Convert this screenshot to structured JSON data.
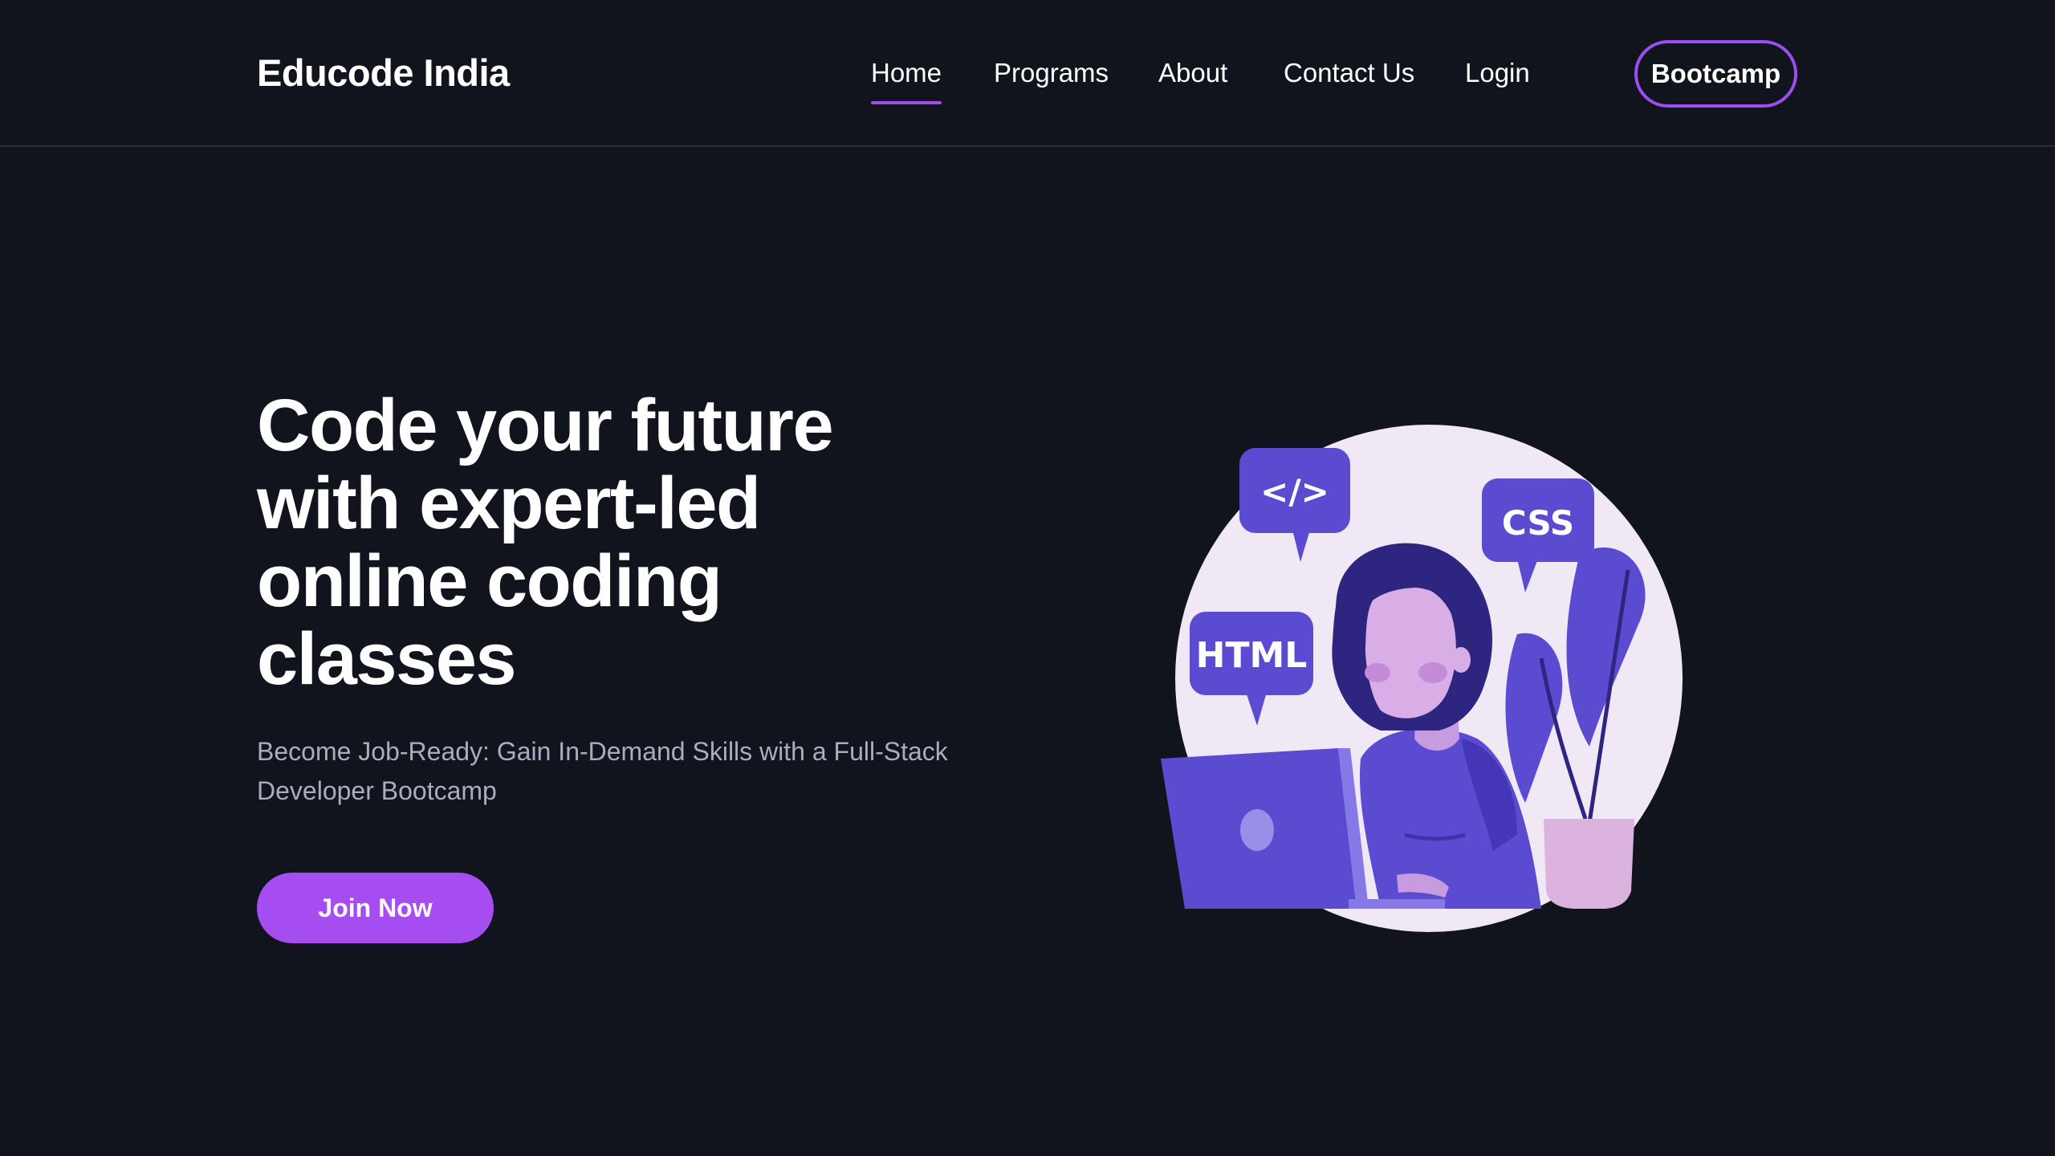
{
  "header": {
    "logo": "Educode India",
    "nav": [
      {
        "label": "Home",
        "active": true
      },
      {
        "label": "Programs",
        "active": false
      },
      {
        "label": "About",
        "active": false
      },
      {
        "label": "Contact Us",
        "active": false
      },
      {
        "label": "Login",
        "active": false
      }
    ],
    "cta_label": "Bootcamp"
  },
  "hero": {
    "title": "Code your future with expert-led online coding classes",
    "subtitle": "Become Job-Ready: Gain In-Demand Skills with a Full-Stack Developer Bootcamp",
    "button_label": "Join Now"
  },
  "illustration": {
    "bubbles": {
      "code": "</>",
      "css": "CSS",
      "html": "HTML"
    },
    "icons": [
      "code-bubble-icon",
      "css-bubble-icon",
      "html-bubble-icon",
      "laptop-icon",
      "plant-icon"
    ]
  },
  "colors": {
    "background": "#11131d",
    "accent": "#a64df2",
    "accent_border": "#9b4ff0",
    "illustration_primary": "#5b4bd1",
    "illustration_circle": "#f1e8f6",
    "subtitle_text": "#a9adc0"
  }
}
